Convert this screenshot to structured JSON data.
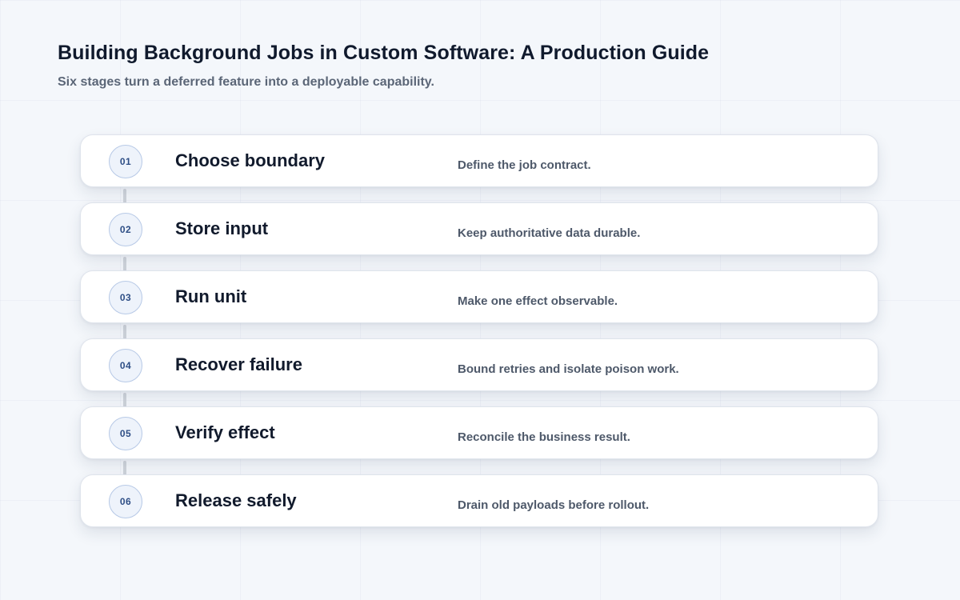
{
  "header": {
    "title": "Building Background Jobs in Custom Software: A Production Guide",
    "subtitle": "Six stages turn a deferred feature into a deployable capability."
  },
  "steps": [
    {
      "number": "01",
      "title": "Choose boundary",
      "description": "Define the job contract."
    },
    {
      "number": "02",
      "title": "Store input",
      "description": "Keep authoritative data durable."
    },
    {
      "number": "03",
      "title": "Run unit",
      "description": "Make one effect observable."
    },
    {
      "number": "04",
      "title": "Recover failure",
      "description": "Bound retries and isolate poison work."
    },
    {
      "number": "05",
      "title": "Verify effect",
      "description": "Reconcile the business result."
    },
    {
      "number": "06",
      "title": "Release safely",
      "description": "Drain old payloads before rollout."
    }
  ],
  "colors": {
    "background": "#f4f7fb",
    "card": "#ffffff",
    "badge_fill": "#eef3fb",
    "badge_border": "#b7c9e6",
    "badge_text": "#2f4f86",
    "connector": "#cfd4db"
  }
}
